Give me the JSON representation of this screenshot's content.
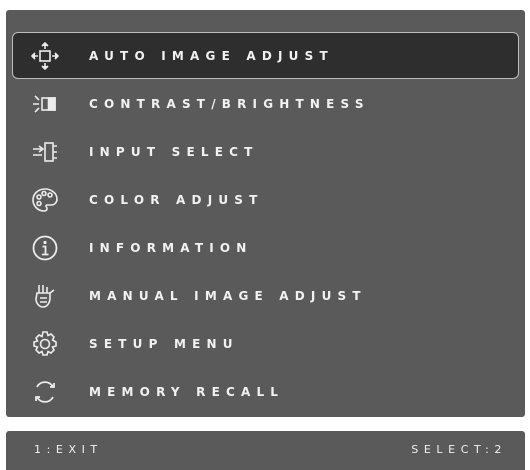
{
  "menu": {
    "selected_index": 0,
    "items": [
      {
        "label": "AUTO IMAGE ADJUST",
        "icon": "auto-image-adjust-icon"
      },
      {
        "label": "CONTRAST/BRIGHTNESS",
        "icon": "contrast-brightness-icon"
      },
      {
        "label": "INPUT SELECT",
        "icon": "input-select-icon"
      },
      {
        "label": "COLOR ADJUST",
        "icon": "color-palette-icon"
      },
      {
        "label": "INFORMATION",
        "icon": "info-icon"
      },
      {
        "label": "MANUAL IMAGE ADJUST",
        "icon": "manual-image-adjust-icon"
      },
      {
        "label": "SETUP MENU",
        "icon": "gear-icon"
      },
      {
        "label": "MEMORY RECALL",
        "icon": "memory-recall-icon"
      }
    ]
  },
  "footer": {
    "exit_label": "1:EXIT",
    "select_label": "SELECT:2"
  },
  "colors": {
    "panel": "#5a5a5a",
    "selected_bg": "#2e2e2e",
    "text": "#f2f2f2"
  }
}
